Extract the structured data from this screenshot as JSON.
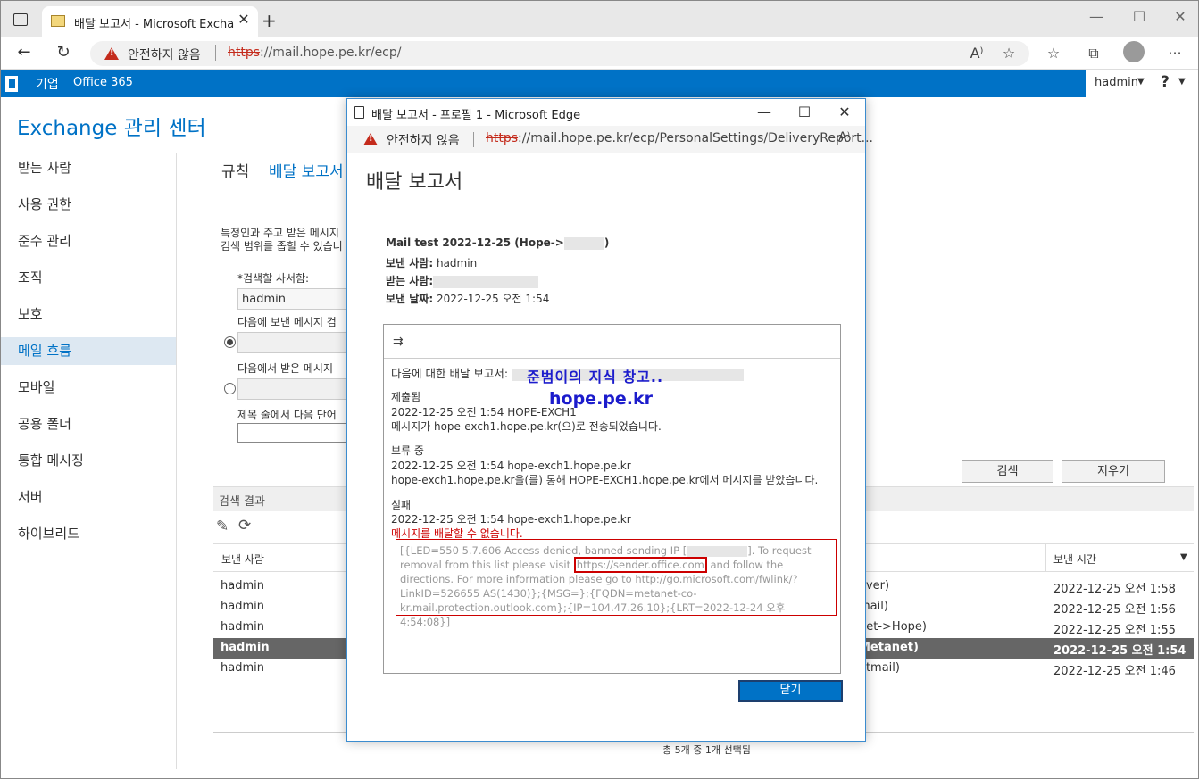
{
  "browser": {
    "tab_title": "배달 보고서 - Microsoft Exchange",
    "tab_close": "✕",
    "new_tab": "+",
    "window_controls": [
      "—",
      "☐",
      "✕"
    ],
    "not_secure": "안전하지 않음",
    "url_scheme": "https",
    "url_rest": "://mail.hope.pe.kr/ecp/",
    "icons": [
      "read-aloud-icon",
      "favorite-add-icon",
      "favorites-icon",
      "collections-icon",
      "profile-icon",
      "more-icon"
    ],
    "more": "···"
  },
  "o365": {
    "enterprise": "기업",
    "office365": "Office 365",
    "user": "hadmin",
    "help": "?"
  },
  "ecp": {
    "title": "Exchange 관리 센터",
    "sidebar": [
      {
        "label": "받는 사람"
      },
      {
        "label": "사용 권한"
      },
      {
        "label": "준수 관리"
      },
      {
        "label": "조직"
      },
      {
        "label": "보호"
      },
      {
        "label": "메일 흐름",
        "active": true
      },
      {
        "label": "모바일"
      },
      {
        "label": "공용 폴더"
      },
      {
        "label": "통합 메시징"
      },
      {
        "label": "서버"
      },
      {
        "label": "하이브리드"
      }
    ],
    "tabs": {
      "rules": "규칙",
      "delivery": "배달 보고서"
    },
    "desc_line1": "특정인과 주고 받은 메시지",
    "desc_line2": "검색 범위를 좁힐 수 있습니",
    "mailbox_label": "*검색할 사서함:",
    "mailbox_value": "hadmin",
    "sent_label": "다음에 보낸 메시지 검",
    "received_label": "다음에서 받은 메시지",
    "subject_label": "제목 줄에서 다음 단어",
    "search_button": "검색",
    "clear_button": "지우기",
    "results_title": "검색 결과",
    "col_sender": "보낸 사람",
    "col_time": "보낸 시간",
    "rows": [
      {
        "sender": "hadmin",
        "subject": "aver)",
        "time": "2022-12-25 오전 1:58"
      },
      {
        "sender": "hadmin",
        "subject": "mail)",
        "time": "2022-12-25 오전 1:56"
      },
      {
        "sender": "hadmin",
        "subject": "net->Hope)",
        "time": "2022-12-25 오전 1:55"
      },
      {
        "sender": "hadmin",
        "subject": "Metanet)",
        "time": "2022-12-25 오전 1:54",
        "selected": true
      },
      {
        "sender": "hadmin",
        "subject": "otmail)",
        "time": "2022-12-25 오전 1:46"
      }
    ],
    "footer": "총 5개 중 1개 선택됨"
  },
  "popup": {
    "title": "배달 보고서 - 프로필 1 - Microsoft Edge",
    "not_secure": "안전하지 않음",
    "url_scheme": "https",
    "url_rest": "://mail.hope.pe.kr/ecp/PersonalSettings/DeliveryReport...",
    "heading": "배달 보고서",
    "subject": "Mail test 2022-12-25 (Hope->",
    "subject_end": ")",
    "from_label": "보낸 사람:",
    "from_value": "hadmin",
    "to_label": "받는 사람:",
    "sent_label": "보낸 날짜:",
    "sent_value": "2022-12-25 오전 1:54",
    "report_for": "다음에 대한 배달 보고서:",
    "submitted_title": "제출됨",
    "submitted_time": "2022-12-25 오전 1:54 HOPE-EXCH1",
    "submitted_msg": "메시지가 hope-exch1.hope.pe.kr(으)로 전송되었습니다.",
    "pending_title": "보류 중",
    "pending_time": "2022-12-25 오전 1:54 hope-exch1.hope.pe.kr",
    "pending_msg": "hope-exch1.hope.pe.kr을(를) 통해 HOPE-EXCH1.hope.pe.kr에서 메시지를 받았습니다.",
    "failed_title": "실패",
    "failed_time": "2022-12-25 오전 1:54 hope-exch1.hope.pe.kr",
    "failed_msg": "메시지를 배달할 수 없습니다.",
    "error_part1": "[{LED=550 5.7.606 Access denied, banned sending IP [",
    "error_part2": "]. To request removal from this list please visit ",
    "error_link": "https://sender.office.com",
    "error_part3": " and follow the directions. For more information please go to http://go.microsoft.com/fwlink/?LinkID=526655 AS(1430)};{MSG=};{FQDN=metanet-co-kr.mail.protection.outlook.com};{IP=104.47.26.10};{LRT=2022-12-24 오후 4:54:08}]",
    "watermark1": "준범이의 지식 창고..",
    "watermark2": "hope.pe.kr",
    "close": "닫기"
  },
  "colors": {
    "accent": "#0072c6",
    "error": "#c00000"
  }
}
